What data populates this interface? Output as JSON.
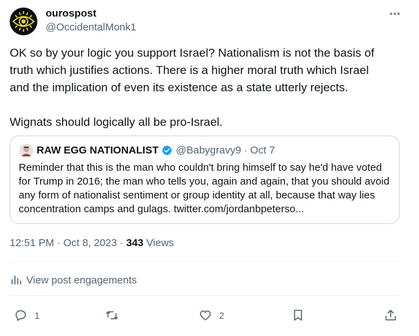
{
  "author": {
    "display_name": "ourospost",
    "handle": "@OccidentalMonk1"
  },
  "tweet": {
    "paragraphs": [
      "OK so by your logic you support Israel? Nationalism is not the basis of truth which justifies actions. There is a higher moral truth which Israel and the implication of even its existence as a state utterly rejects.",
      "Wignats should logically all be pro-Israel."
    ]
  },
  "quoted": {
    "display_name": "RAW EGG NATIONALIST",
    "handle": "@Babygravy9",
    "separator": "·",
    "date": "Oct 7",
    "text": "Reminder that this is the man who couldn't bring himself to say he'd have voted for Trump in 2016; the man who tells you, again and again, that you should avoid any form of nationalist sentiment or group identity at all, because that way lies concentration camps and gulags. twitter.com/jordanbpeterso..."
  },
  "meta": {
    "time": "12:51 PM",
    "separator1": "·",
    "date": "Oct 8, 2023",
    "separator2": "·",
    "views_count": "343",
    "views_label": "Views"
  },
  "engagements_label": "View post engagements",
  "actions": {
    "reply_count": "1",
    "repost_count": "",
    "like_count": "2"
  },
  "colors": {
    "text": "#0f1419",
    "secondary": "#536471",
    "border": "#cfd9de",
    "verified": "#1d9bf0"
  },
  "icons": [
    "avatar-eye-icon",
    "more-icon",
    "verified-icon",
    "analytics-icon",
    "reply-icon",
    "repost-icon",
    "like-icon",
    "bookmark-icon",
    "share-icon"
  ]
}
